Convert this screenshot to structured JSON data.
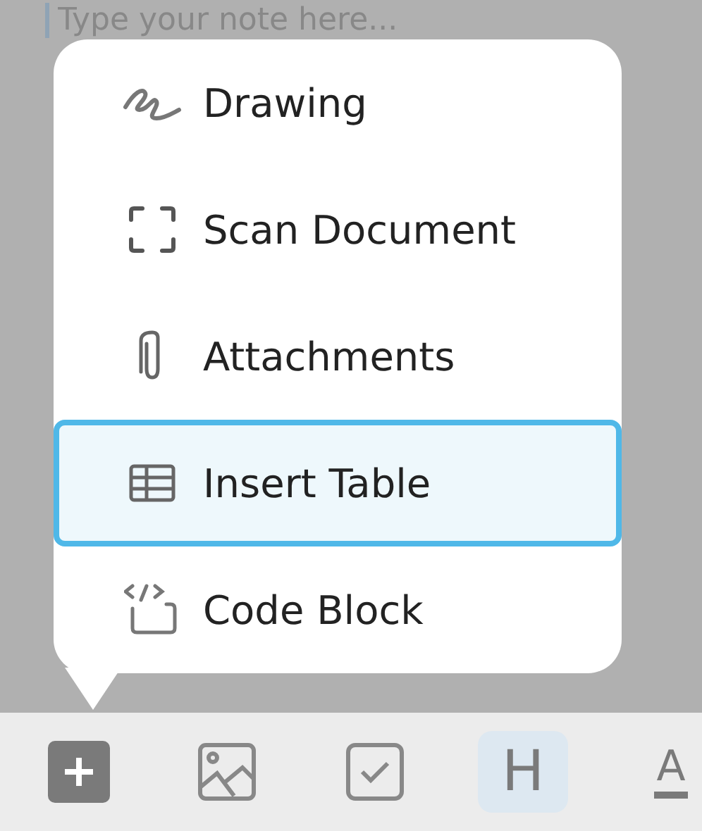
{
  "editor": {
    "placeholder": "Type your note here..."
  },
  "menu": {
    "items": [
      {
        "kind": "drawing",
        "label": "Drawing",
        "selected": false
      },
      {
        "kind": "scan",
        "label": "Scan Document",
        "selected": false
      },
      {
        "kind": "attach",
        "label": "Attachments",
        "selected": false
      },
      {
        "kind": "table",
        "label": "Insert Table",
        "selected": true
      },
      {
        "kind": "code",
        "label": "Code Block",
        "selected": false
      }
    ]
  },
  "toolbar": {
    "items": [
      {
        "kind": "plus",
        "selected": false
      },
      {
        "kind": "image",
        "selected": false
      },
      {
        "kind": "check",
        "selected": false
      },
      {
        "kind": "letter",
        "text": "H",
        "selected": true
      },
      {
        "kind": "underline",
        "text": "A",
        "selected": false
      }
    ]
  }
}
